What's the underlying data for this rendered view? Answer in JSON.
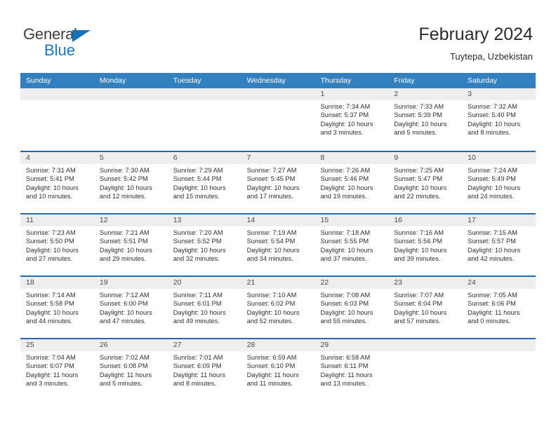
{
  "logo": {
    "word_top": "General",
    "word_bottom": "Blue",
    "triangle_icon": "triangle-icon",
    "accent_color": "#1b76c4"
  },
  "header": {
    "title": "February 2024",
    "subtitle": "Tuytepa, Uzbekistan"
  },
  "colors": {
    "header_bar": "#3280c0",
    "row_divider": "#1f6cb0",
    "day_band": "#eeeeee",
    "text": "#2f2f2f"
  },
  "weekdays": [
    "Sunday",
    "Monday",
    "Tuesday",
    "Wednesday",
    "Thursday",
    "Friday",
    "Saturday"
  ],
  "weeks": [
    [
      {
        "day": "",
        "empty": true
      },
      {
        "day": "",
        "empty": true
      },
      {
        "day": "",
        "empty": true
      },
      {
        "day": "",
        "empty": true
      },
      {
        "day": "1",
        "sunrise": "Sunrise: 7:34 AM",
        "sunset": "Sunset: 5:37 PM",
        "daylight": "Daylight: 10 hours and 3 minutes."
      },
      {
        "day": "2",
        "sunrise": "Sunrise: 7:33 AM",
        "sunset": "Sunset: 5:39 PM",
        "daylight": "Daylight: 10 hours and 5 minutes."
      },
      {
        "day": "3",
        "sunrise": "Sunrise: 7:32 AM",
        "sunset": "Sunset: 5:40 PM",
        "daylight": "Daylight: 10 hours and 8 minutes."
      }
    ],
    [
      {
        "day": "4",
        "sunrise": "Sunrise: 7:31 AM",
        "sunset": "Sunset: 5:41 PM",
        "daylight": "Daylight: 10 hours and 10 minutes."
      },
      {
        "day": "5",
        "sunrise": "Sunrise: 7:30 AM",
        "sunset": "Sunset: 5:42 PM",
        "daylight": "Daylight: 10 hours and 12 minutes."
      },
      {
        "day": "6",
        "sunrise": "Sunrise: 7:29 AM",
        "sunset": "Sunset: 5:44 PM",
        "daylight": "Daylight: 10 hours and 15 minutes."
      },
      {
        "day": "7",
        "sunrise": "Sunrise: 7:27 AM",
        "sunset": "Sunset: 5:45 PM",
        "daylight": "Daylight: 10 hours and 17 minutes."
      },
      {
        "day": "8",
        "sunrise": "Sunrise: 7:26 AM",
        "sunset": "Sunset: 5:46 PM",
        "daylight": "Daylight: 10 hours and 19 minutes."
      },
      {
        "day": "9",
        "sunrise": "Sunrise: 7:25 AM",
        "sunset": "Sunset: 5:47 PM",
        "daylight": "Daylight: 10 hours and 22 minutes."
      },
      {
        "day": "10",
        "sunrise": "Sunrise: 7:24 AM",
        "sunset": "Sunset: 5:49 PM",
        "daylight": "Daylight: 10 hours and 24 minutes."
      }
    ],
    [
      {
        "day": "11",
        "sunrise": "Sunrise: 7:23 AM",
        "sunset": "Sunset: 5:50 PM",
        "daylight": "Daylight: 10 hours and 27 minutes."
      },
      {
        "day": "12",
        "sunrise": "Sunrise: 7:21 AM",
        "sunset": "Sunset: 5:51 PM",
        "daylight": "Daylight: 10 hours and 29 minutes."
      },
      {
        "day": "13",
        "sunrise": "Sunrise: 7:20 AM",
        "sunset": "Sunset: 5:52 PM",
        "daylight": "Daylight: 10 hours and 32 minutes."
      },
      {
        "day": "14",
        "sunrise": "Sunrise: 7:19 AM",
        "sunset": "Sunset: 5:54 PM",
        "daylight": "Daylight: 10 hours and 34 minutes."
      },
      {
        "day": "15",
        "sunrise": "Sunrise: 7:18 AM",
        "sunset": "Sunset: 5:55 PM",
        "daylight": "Daylight: 10 hours and 37 minutes."
      },
      {
        "day": "16",
        "sunrise": "Sunrise: 7:16 AM",
        "sunset": "Sunset: 5:56 PM",
        "daylight": "Daylight: 10 hours and 39 minutes."
      },
      {
        "day": "17",
        "sunrise": "Sunrise: 7:15 AM",
        "sunset": "Sunset: 5:57 PM",
        "daylight": "Daylight: 10 hours and 42 minutes."
      }
    ],
    [
      {
        "day": "18",
        "sunrise": "Sunrise: 7:14 AM",
        "sunset": "Sunset: 5:58 PM",
        "daylight": "Daylight: 10 hours and 44 minutes."
      },
      {
        "day": "19",
        "sunrise": "Sunrise: 7:12 AM",
        "sunset": "Sunset: 6:00 PM",
        "daylight": "Daylight: 10 hours and 47 minutes."
      },
      {
        "day": "20",
        "sunrise": "Sunrise: 7:11 AM",
        "sunset": "Sunset: 6:01 PM",
        "daylight": "Daylight: 10 hours and 49 minutes."
      },
      {
        "day": "21",
        "sunrise": "Sunrise: 7:10 AM",
        "sunset": "Sunset: 6:02 PM",
        "daylight": "Daylight: 10 hours and 52 minutes."
      },
      {
        "day": "22",
        "sunrise": "Sunrise: 7:08 AM",
        "sunset": "Sunset: 6:03 PM",
        "daylight": "Daylight: 10 hours and 55 minutes."
      },
      {
        "day": "23",
        "sunrise": "Sunrise: 7:07 AM",
        "sunset": "Sunset: 6:04 PM",
        "daylight": "Daylight: 10 hours and 57 minutes."
      },
      {
        "day": "24",
        "sunrise": "Sunrise: 7:05 AM",
        "sunset": "Sunset: 6:06 PM",
        "daylight": "Daylight: 11 hours and 0 minutes."
      }
    ],
    [
      {
        "day": "25",
        "sunrise": "Sunrise: 7:04 AM",
        "sunset": "Sunset: 6:07 PM",
        "daylight": "Daylight: 11 hours and 3 minutes."
      },
      {
        "day": "26",
        "sunrise": "Sunrise: 7:02 AM",
        "sunset": "Sunset: 6:08 PM",
        "daylight": "Daylight: 11 hours and 5 minutes."
      },
      {
        "day": "27",
        "sunrise": "Sunrise: 7:01 AM",
        "sunset": "Sunset: 6:09 PM",
        "daylight": "Daylight: 11 hours and 8 minutes."
      },
      {
        "day": "28",
        "sunrise": "Sunrise: 6:59 AM",
        "sunset": "Sunset: 6:10 PM",
        "daylight": "Daylight: 11 hours and 11 minutes."
      },
      {
        "day": "29",
        "sunrise": "Sunrise: 6:58 AM",
        "sunset": "Sunset: 6:11 PM",
        "daylight": "Daylight: 11 hours and 13 minutes."
      },
      {
        "day": "",
        "empty": true
      },
      {
        "day": "",
        "empty": true
      }
    ]
  ]
}
